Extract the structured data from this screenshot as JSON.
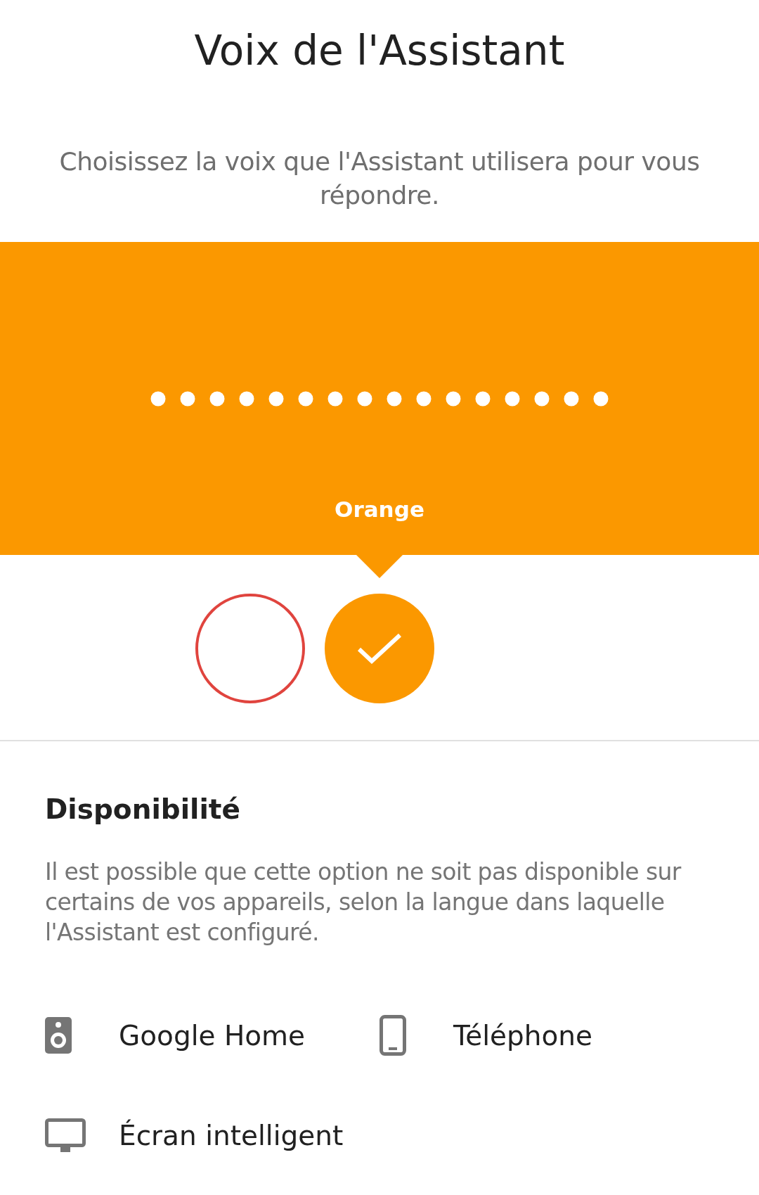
{
  "title": "Voix de l'Assistant",
  "subtitle": "Choisissez la voix que l'Assistant utilisera pour vous répondre.",
  "voice_panel": {
    "name": "Orange"
  },
  "voices": [
    {
      "color": "#e0443e",
      "selected": false
    },
    {
      "color": "#fb9800",
      "selected": true
    }
  ],
  "availability": {
    "heading": "Disponibilité",
    "text": "Il est possible que cette option ne soit pas disponible sur certains de vos appareils, selon la langue dans laquelle l'Assistant est configuré.",
    "devices": [
      {
        "kind": "speaker",
        "label": "Google Home"
      },
      {
        "kind": "phone",
        "label": "Téléphone"
      },
      {
        "kind": "display",
        "label": "Écran intelligent"
      }
    ]
  }
}
